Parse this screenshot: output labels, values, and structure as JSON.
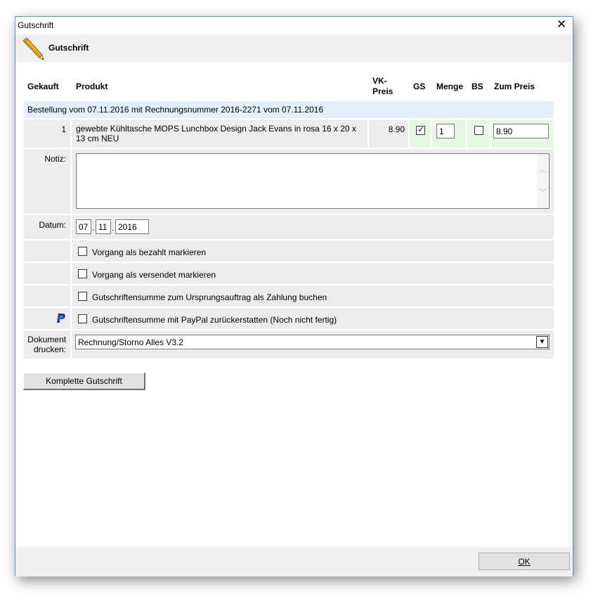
{
  "window": {
    "title": "Gutschrift",
    "close_glyph": "✕"
  },
  "header": {
    "title": "Gutschrift",
    "icon": "pencil-icon"
  },
  "columns": {
    "gekauft": "Gekauft",
    "produkt": "Produkt",
    "vk_preis_1": "VK-",
    "vk_preis_2": "Preis",
    "gs": "GS",
    "menge": "Menge",
    "bs": "BS",
    "zum_preis": "Zum Preis"
  },
  "order": {
    "description": "Bestellung vom 07.11.2016 mit Rechnungsnummer 2016-2271 vom 07.11.2016"
  },
  "item": {
    "gekauft": "1",
    "produkt": "gewebte Kühltasche MOPS Lunchbox Design Jack Evans in rosa 16 x 20 x 13 cm NEU",
    "vk_preis": "8.90",
    "gs_checked": true,
    "gs_mark": "✓",
    "menge": "1",
    "bs_checked": false,
    "zum_preis": "8.90"
  },
  "notiz": {
    "label": "Notiz:",
    "value": ""
  },
  "datum": {
    "label": "Datum:",
    "day": "07",
    "month": "11",
    "year": "2016",
    "sep": "."
  },
  "options": [
    {
      "label": "Vorgang als bezahlt markieren",
      "checked": false
    },
    {
      "label": "Vorgang als versendet markieren",
      "checked": false
    },
    {
      "label": "Gutschriftensumme zum Ursprungsauftrag als Zahlung buchen",
      "checked": false
    },
    {
      "label": "Gutschriftensumme mit PayPal zurückerstatten (Noch nicht fertig)",
      "checked": false,
      "icon": "paypal-icon"
    }
  ],
  "dokument": {
    "label_1": "Dokument",
    "label_2": "drucken:",
    "selected": "Rechnung/Storno Alles V3.2"
  },
  "buttons": {
    "komplette": "Komplette Gutschrift",
    "ok": "OK"
  },
  "colors": {
    "order_row": "#e6eef9",
    "gs_cell": "#e6f7e3",
    "row_bg": "#ececec",
    "paypal": "#1f3a8a"
  }
}
